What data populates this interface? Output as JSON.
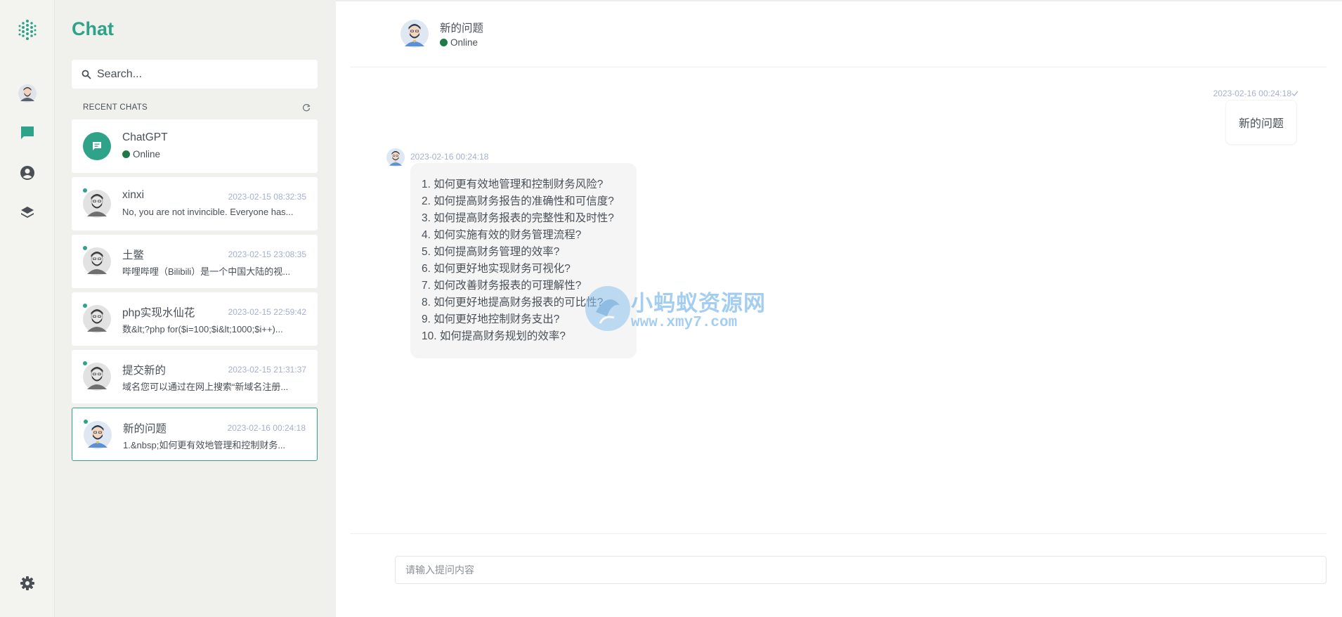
{
  "colors": {
    "accent": "#2fa38a",
    "online": "#1f7a4a",
    "panel_bg": "#f0f0ec",
    "rail_bg": "#f3f3f0",
    "timestamp": "#a6b0cf"
  },
  "rail": {
    "items": [
      {
        "icon": "logo-icon"
      },
      {
        "icon": "avatar-icon"
      },
      {
        "icon": "chat-icon",
        "active": true
      },
      {
        "icon": "user-circle-icon"
      },
      {
        "icon": "layers-icon"
      },
      {
        "icon": "gear-icon"
      }
    ]
  },
  "sidebar": {
    "title": "Chat",
    "search_placeholder": "Search...",
    "section_label": "RECENT CHATS",
    "section_icon": "refresh-icon",
    "bot": {
      "name": "ChatGPT",
      "status": "Online",
      "icon": "message-icon"
    },
    "chats": [
      {
        "name": "xinxi",
        "time": "2023-02-15 08:32:35",
        "preview": "No, you are not invincible. Everyone has..."
      },
      {
        "name": "土鳖",
        "time": "2023-02-15 23:08:35",
        "preview": "哔哩哔哩（Bilibili）是一个中国大陆的视..."
      },
      {
        "name": "php实现水仙花",
        "time": "2023-02-15 22:59:42",
        "preview": "数&lt;?php for($i=100;$i&lt;1000;$i++)..."
      },
      {
        "name": "提交新的",
        "time": "2023-02-15 21:31:37",
        "preview": "域名您可以通过在网上搜索“新域名注册..."
      },
      {
        "name": "新的问题",
        "time": "2023-02-16 00:24:18",
        "preview": "1.&nbsp;如何更有效地管理和控制财务...",
        "active": true
      }
    ]
  },
  "chat": {
    "title": "新的问题",
    "status": "Online",
    "sent": {
      "time": "2023-02-16 00:24:18",
      "text": "新的问题"
    },
    "reply": {
      "time": "2023-02-16 00:24:18",
      "lines": [
        "1. 如何更有效地管理和控制财务风险?",
        "2. 如何提高财务报告的准确性和可信度?",
        "3. 如何提高财务报表的完整性和及时性?",
        "4. 如何实施有效的财务管理流程?",
        "5. 如何提高财务管理的效率?",
        "6. 如何更好地实现财务可视化?",
        "7. 如何改善财务报表的可理解性?",
        "8. 如何更好地提高财务报表的可比性?",
        "9. 如何更好地控制财务支出?",
        "10. 如何提高财务规划的效率?"
      ]
    },
    "watermark": {
      "title": "小蚂蚁资源网",
      "url": "www.xmy7.com"
    },
    "composer_placeholder": "请输入提问内容"
  }
}
